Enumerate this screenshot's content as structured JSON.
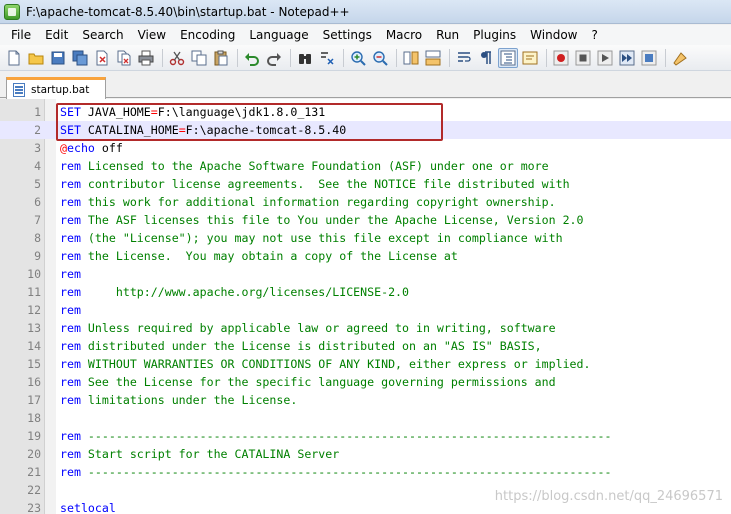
{
  "window": {
    "title": "F:\\apache-tomcat-8.5.40\\bin\\startup.bat - Notepad++"
  },
  "menu": [
    "File",
    "Edit",
    "Search",
    "View",
    "Encoding",
    "Language",
    "Settings",
    "Macro",
    "Run",
    "Plugins",
    "Window",
    "?"
  ],
  "tab": {
    "label": "startup.bat"
  },
  "editor": {
    "lines": [
      {
        "num": "1",
        "kind": "set",
        "kw": "SET",
        "var": " JAVA_HOME",
        "eq": "=",
        "val": "F:\\language\\jdk1.8.0_131"
      },
      {
        "num": "2",
        "kind": "set",
        "kw": "SET",
        "var": " CATALINA_HOME",
        "eq": "=",
        "val": "F:\\apache-tomcat-8.5.40",
        "current": true
      },
      {
        "num": "3",
        "kind": "echo",
        "at": "@",
        "cmd": "echo",
        "rest": " off"
      },
      {
        "num": "4",
        "kind": "rem",
        "kw": "rem",
        "text": " Licensed to the Apache Software Foundation (ASF) under one or more"
      },
      {
        "num": "5",
        "kind": "rem",
        "kw": "rem",
        "text": " contributor license agreements.  See the NOTICE file distributed with"
      },
      {
        "num": "6",
        "kind": "rem",
        "kw": "rem",
        "text": " this work for additional information regarding copyright ownership."
      },
      {
        "num": "7",
        "kind": "rem",
        "kw": "rem",
        "text": " The ASF licenses this file to You under the Apache License, Version 2.0"
      },
      {
        "num": "8",
        "kind": "rem",
        "kw": "rem",
        "text": " (the \"License\"); you may not use this file except in compliance with"
      },
      {
        "num": "9",
        "kind": "rem",
        "kw": "rem",
        "text": " the License.  You may obtain a copy of the License at"
      },
      {
        "num": "10",
        "kind": "rem",
        "kw": "rem",
        "text": ""
      },
      {
        "num": "11",
        "kind": "rem",
        "kw": "rem",
        "text": "     http://www.apache.org/licenses/LICENSE-2.0"
      },
      {
        "num": "12",
        "kind": "rem",
        "kw": "rem",
        "text": ""
      },
      {
        "num": "13",
        "kind": "rem",
        "kw": "rem",
        "text": " Unless required by applicable law or agreed to in writing, software"
      },
      {
        "num": "14",
        "kind": "rem",
        "kw": "rem",
        "text": " distributed under the License is distributed on an \"AS IS\" BASIS,"
      },
      {
        "num": "15",
        "kind": "rem",
        "kw": "rem",
        "text": " WITHOUT WARRANTIES OR CONDITIONS OF ANY KIND, either express or implied."
      },
      {
        "num": "16",
        "kind": "rem",
        "kw": "rem",
        "text": " See the License for the specific language governing permissions and"
      },
      {
        "num": "17",
        "kind": "rem",
        "kw": "rem",
        "text": " limitations under the License."
      },
      {
        "num": "18",
        "kind": "blank"
      },
      {
        "num": "19",
        "kind": "rem",
        "kw": "rem",
        "text": " ---------------------------------------------------------------------------"
      },
      {
        "num": "20",
        "kind": "rem",
        "kw": "rem",
        "text": " Start script for the CATALINA Server"
      },
      {
        "num": "21",
        "kind": "rem",
        "kw": "rem",
        "text": " ---------------------------------------------------------------------------"
      },
      {
        "num": "22",
        "kind": "blank"
      },
      {
        "num": "23",
        "kind": "plain",
        "text": "setlocal"
      }
    ]
  },
  "watermark": "https://blog.csdn.net/qq_24696571",
  "colors": {
    "keyword": "#0000ff",
    "operator": "#ff0000",
    "comment": "#008000",
    "current_line": "#e8e8ff",
    "highlight_box": "#b22a2a",
    "tab_accent": "#f9a33c"
  }
}
